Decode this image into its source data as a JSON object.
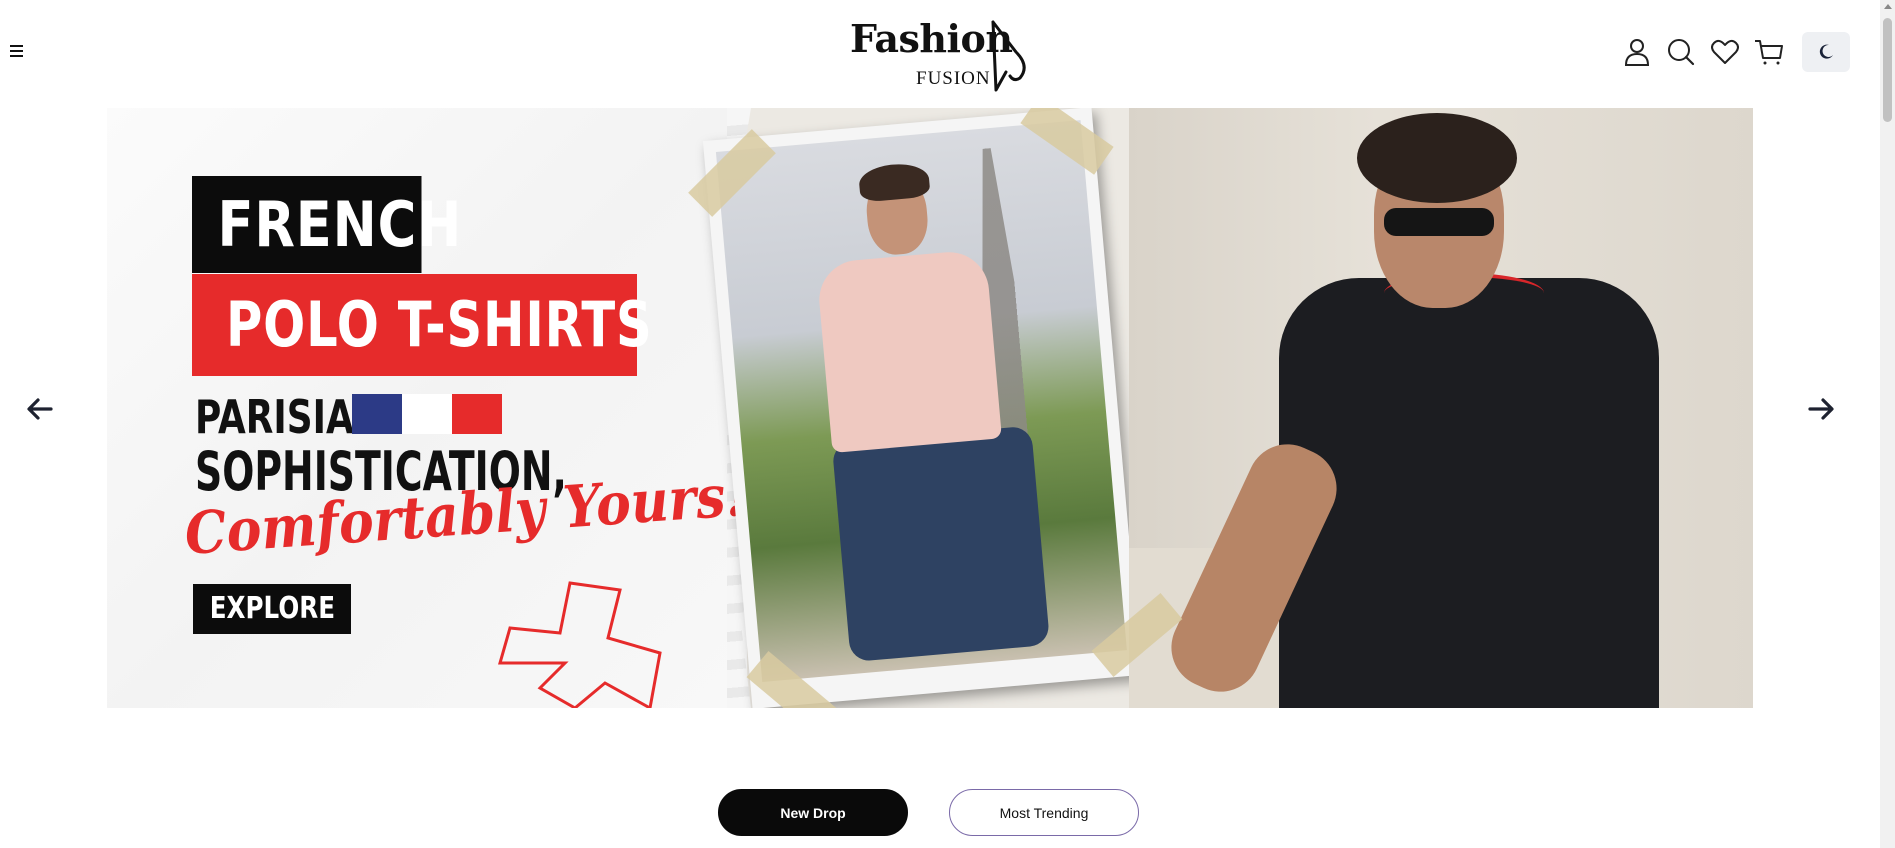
{
  "header": {
    "logo": {
      "brand": "Fashion",
      "sub": "FUSION"
    },
    "icons": [
      "user-icon",
      "search-icon",
      "heart-icon",
      "cart-icon",
      "moon-icon"
    ]
  },
  "banner": {
    "title_line1": "FRENCH",
    "title_line2": "POLO T-SHIRTS",
    "line3": "PARISIAN",
    "line4": "SOPHISTICATION,",
    "script": "Comfortably Yours!",
    "cta": "EXPLORE",
    "flag_colors": [
      "#2c3a86",
      "#ffffff",
      "#e62b2b"
    ]
  },
  "tabs": [
    {
      "label": "New Drop",
      "active": true
    },
    {
      "label": "Most Trending",
      "active": false
    }
  ],
  "colors": {
    "accent_red": "#e62b2b",
    "black": "#0a0a0a",
    "tab_border": "#7a6aa8"
  }
}
